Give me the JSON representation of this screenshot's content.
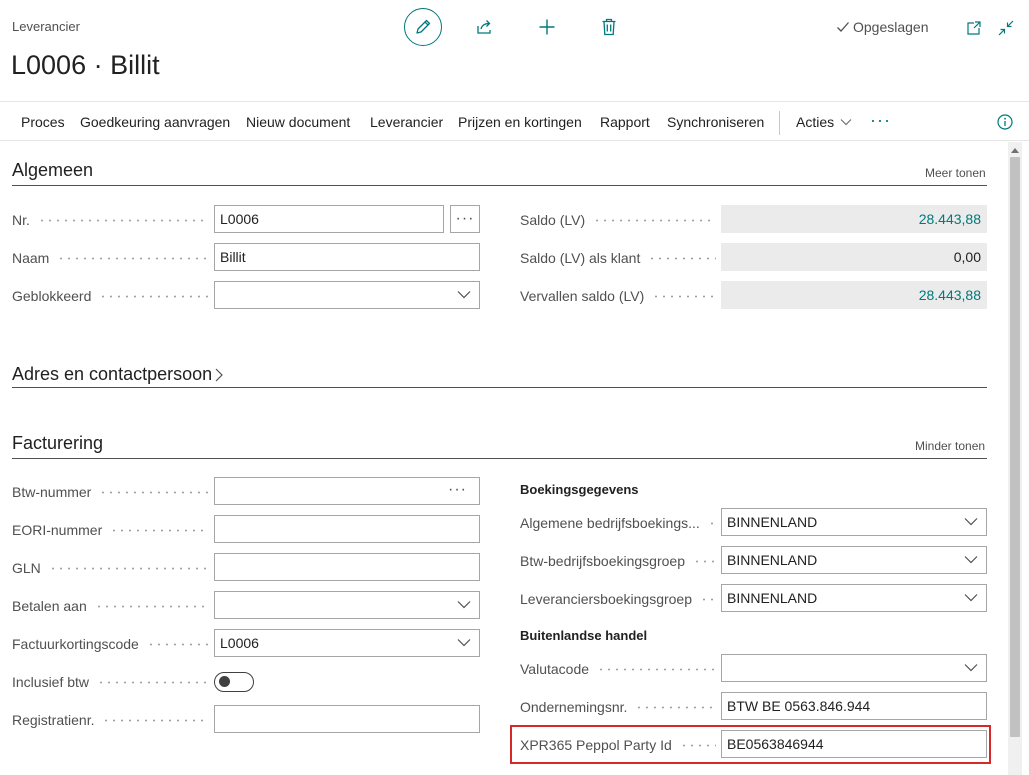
{
  "header": {
    "caption": "Leverancier",
    "title": "L0006 · Billit",
    "saved_label": "Opgeslagen"
  },
  "icons": {
    "edit": "pencil-icon",
    "share": "share-icon",
    "new": "plus-icon",
    "delete": "trash-icon",
    "popout": "open-in-new-icon",
    "collapse": "collapse-icon",
    "info": "info-icon",
    "saved": "checkmark-icon"
  },
  "menu": {
    "items": [
      "Proces",
      "Goedkeuring aanvragen",
      "Nieuw document",
      "Leverancier",
      "Prijzen en kortingen",
      "Rapport",
      "Synchroniseren",
      "Acties"
    ],
    "more": "···"
  },
  "algemeen": {
    "title": "Algemeen",
    "link": "Meer tonen",
    "left": [
      {
        "label": "Nr.",
        "value": "L0006"
      },
      {
        "label": "Naam",
        "value": "Billit"
      },
      {
        "label": "Geblokkeerd",
        "value": ""
      }
    ],
    "right": [
      {
        "label": "Saldo (LV)",
        "value": "28.443,88"
      },
      {
        "label": "Saldo (LV) als klant",
        "value": "0,00"
      },
      {
        "label": "Vervallen saldo (LV)",
        "value": "28.443,88"
      }
    ]
  },
  "adres": {
    "title": "Adres en contactpersoon"
  },
  "facturering": {
    "title": "Facturering",
    "link": "Minder tonen",
    "left": [
      {
        "label": "Btw-nummer",
        "value": ""
      },
      {
        "label": "EORI-nummer",
        "value": ""
      },
      {
        "label": "GLN",
        "value": ""
      },
      {
        "label": "Betalen aan",
        "value": ""
      },
      {
        "label": "Factuurkortingscode",
        "value": "L0006"
      },
      {
        "label": "Inclusief btw",
        "value": false
      },
      {
        "label": "Registratienr.",
        "value": ""
      }
    ],
    "boeking_heading": "Boekingsgegevens",
    "boeking": [
      {
        "label": "Algemene bedrijfsboekings...",
        "value": "BINNENLAND"
      },
      {
        "label": "Btw-bedrijfsboekingsgroep",
        "value": "BINNENLAND"
      },
      {
        "label": "Leveranciersboekingsgroep",
        "value": "BINNENLAND"
      }
    ],
    "buitenland_heading": "Buitenlandse handel",
    "buitenland": [
      {
        "label": "Valutacode",
        "value": ""
      },
      {
        "label": "Ondernemingsnr.",
        "value": "BTW BE 0563.846.944"
      },
      {
        "label": "XPR365 Peppol Party Id",
        "value": "BE0563846944"
      }
    ]
  },
  "colors": {
    "accent": "#00797a",
    "highlight": "#d62a2a"
  }
}
